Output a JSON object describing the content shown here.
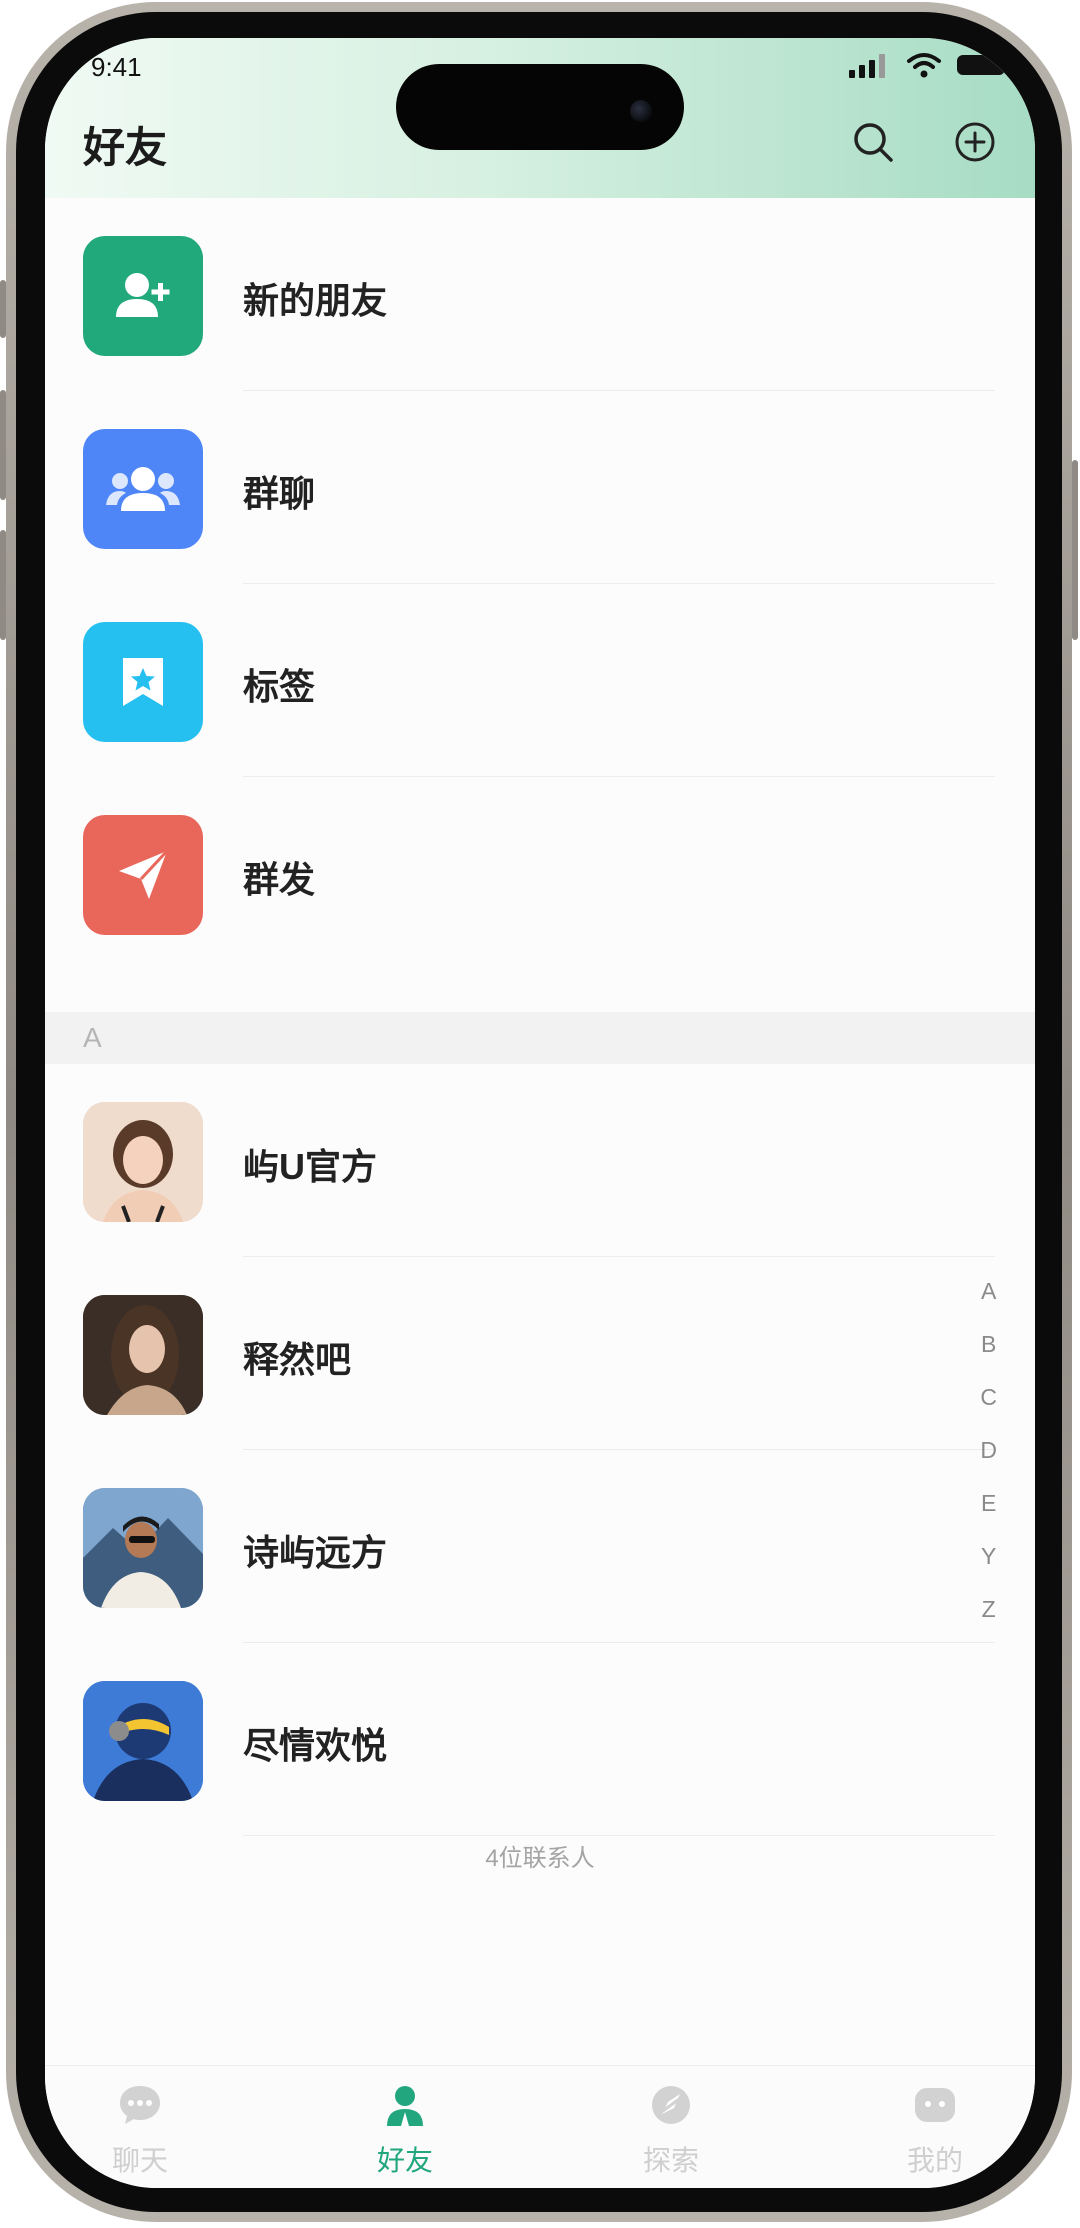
{
  "status": {
    "time": "9:41"
  },
  "header": {
    "title": "好友"
  },
  "menu_items": [
    {
      "label": "新的朋友",
      "icon": "add-friend-icon",
      "color": "#22a97b"
    },
    {
      "label": "群聊",
      "icon": "group-icon",
      "color": "#4e86f7"
    },
    {
      "label": "标签",
      "icon": "tag-icon",
      "color": "#25bff0"
    },
    {
      "label": "群发",
      "icon": "send-icon",
      "color": "#e9665a"
    }
  ],
  "section_letter": "A",
  "contacts": [
    {
      "name": "屿U官方"
    },
    {
      "name": "释然吧"
    },
    {
      "name": "诗屿远方"
    },
    {
      "name": "尽情欢悦"
    }
  ],
  "contact_count": "4位联系人",
  "alphabet_index": [
    "A",
    "B",
    "C",
    "D",
    "E",
    "Y",
    "Z"
  ],
  "tabs": [
    {
      "label": "聊天",
      "icon": "chat-icon",
      "active": false
    },
    {
      "label": "好友",
      "icon": "friends-icon",
      "active": true
    },
    {
      "label": "探索",
      "icon": "explore-icon",
      "active": false
    },
    {
      "label": "我的",
      "icon": "profile-icon",
      "active": false
    }
  ],
  "colors": {
    "accent": "#21a67e",
    "header_gradient_end": "#a7dcc4"
  }
}
